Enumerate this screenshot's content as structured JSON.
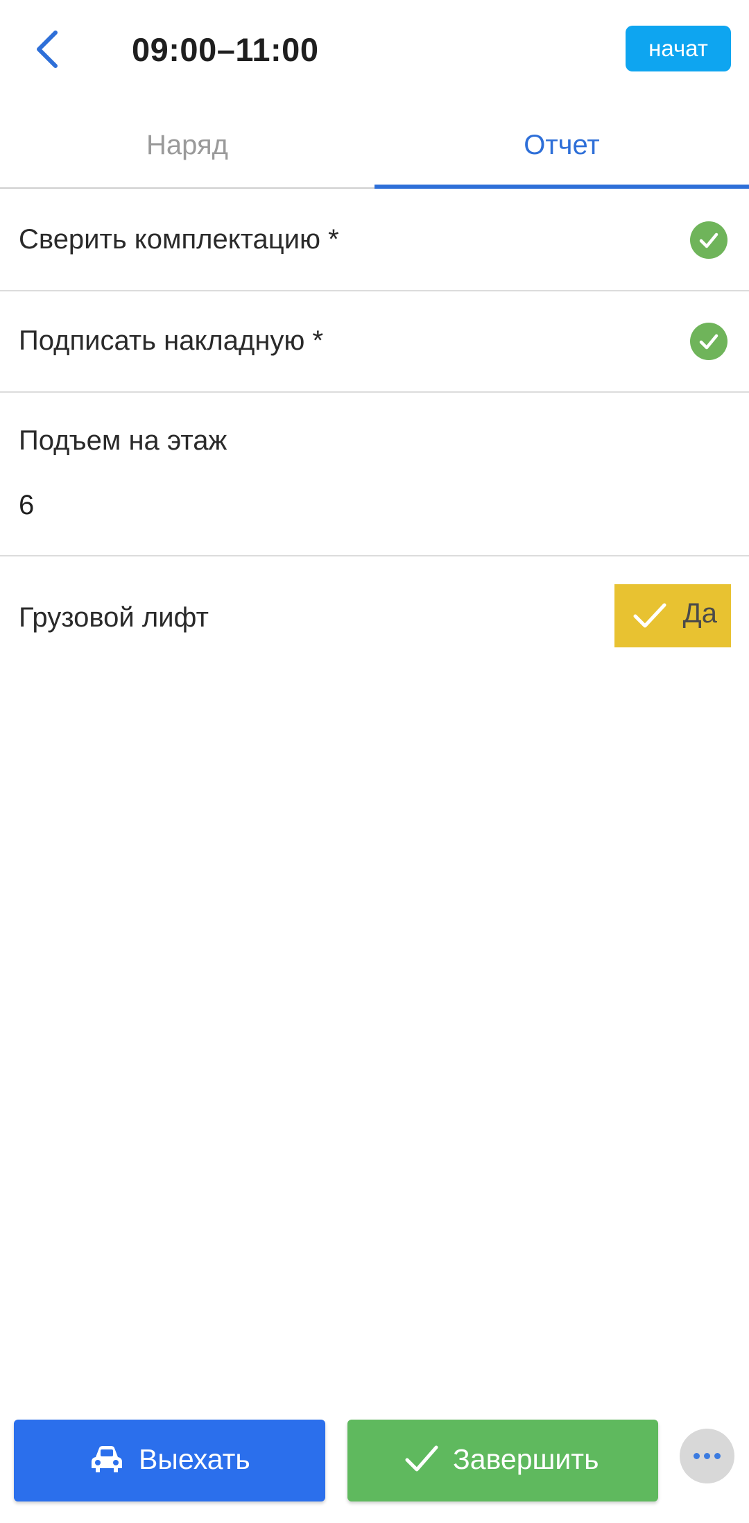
{
  "header": {
    "back_icon": "chevron-left-icon",
    "title": "09:00–11:00",
    "start_label": "начат"
  },
  "tabs": [
    {
      "label": "Наряд",
      "active": false
    },
    {
      "label": "Отчет",
      "active": true
    }
  ],
  "report": {
    "items": [
      {
        "label": "Сверить комплектацию *",
        "checked": true,
        "icon": "check-circle-icon"
      },
      {
        "label": "Подписать накладную *",
        "checked": true,
        "icon": "check-circle-icon"
      }
    ],
    "floor": {
      "label": "Подъем на этаж",
      "value": "6"
    },
    "freight_lift": {
      "label": "Грузовой лифт",
      "toggle_label": "Да",
      "toggle_icon": "check-icon",
      "selected": true
    }
  },
  "actions": {
    "depart": {
      "label": "Выехать",
      "icon": "car-icon"
    },
    "finish": {
      "label": "Завершить",
      "icon": "check-icon"
    },
    "more_icon": "more-horizontal-icon"
  },
  "colors": {
    "accent_blue": "#2e6fd8",
    "start_button": "#0ea5f0",
    "check_green": "#6fb45a",
    "toggle_yellow": "#e8c231",
    "depart_button": "#2b6fec",
    "finish_button": "#5fb95e"
  }
}
